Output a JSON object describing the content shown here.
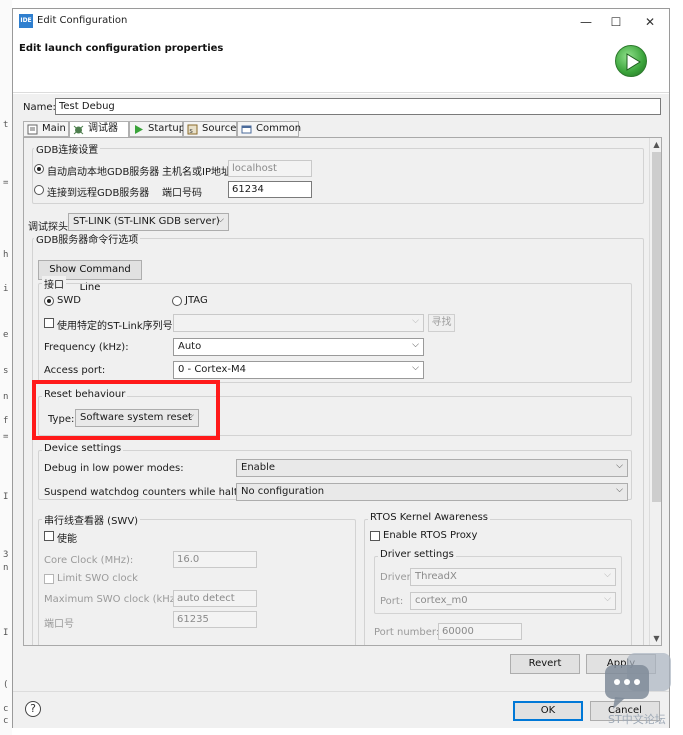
{
  "window": {
    "title": "Edit Configuration",
    "app_icon_text": "IDE",
    "minimize_glyph": "—",
    "maximize_glyph": "☐",
    "close_glyph": "✕"
  },
  "header": {
    "title": "Edit launch configuration properties",
    "icon": "run-debug-icon"
  },
  "name_label": "Name:",
  "name_value": "Test Debug",
  "tabs": [
    {
      "label": "Main",
      "icon": "main-tab-icon"
    },
    {
      "label": "调试器",
      "icon": "debugger-tab-icon",
      "active": true
    },
    {
      "label": "Startup",
      "icon": "startup-tab-icon"
    },
    {
      "label": "Source",
      "icon": "source-tab-icon"
    },
    {
      "label": "Common",
      "icon": "common-tab-icon"
    }
  ],
  "gdb_connection": {
    "group_label": "GDB连接设置",
    "local_radio": "自动启动本地GDB服务器",
    "host_label": "主机名或IP地址",
    "host_value": "localhost",
    "remote_radio": "连接到远程GDB服务器",
    "port_label": "端口号码",
    "port_value": "61234"
  },
  "probe": {
    "label": "调试探头",
    "value": "ST-LINK (ST-LINK GDB server)"
  },
  "gdb_server_options": {
    "group_label": "GDB服务器命令行选项",
    "show_cmd_button": "Show Command Line"
  },
  "interface": {
    "group_label": "接口",
    "swd": "SWD",
    "jtag": "JTAG",
    "serial_checkbox": "使用特定的ST-Link序列号",
    "scan_button": "寻找",
    "freq_label": "Frequency (kHz):",
    "freq_value": "Auto",
    "access_label": "Access port:",
    "access_value": "0 - Cortex-M4"
  },
  "reset": {
    "group_label": "Reset behaviour",
    "type_label": "Type:",
    "type_value": "Software system reset"
  },
  "device": {
    "group_label": "Device settings",
    "low_power_label": "Debug in low power modes:",
    "low_power_value": "Enable",
    "watchdog_label": "Suspend watchdog counters while halted:",
    "watchdog_value": "No configuration"
  },
  "swv": {
    "group_label": "串行线查看器 (SWV)",
    "enable_label": "使能",
    "core_clock_label": "Core Clock (MHz):",
    "core_clock_value": "16.0",
    "limit_swo_label": "Limit SWO clock",
    "max_swo_label": "Maximum SWO clock (kHz):",
    "max_swo_value": "auto detect",
    "port_label": "端口号",
    "port_value": "61235"
  },
  "rtos": {
    "group_label": "RTOS Kernel Awareness",
    "enable_label": "Enable RTOS Proxy",
    "driver_group_label": "Driver settings",
    "driver_label": "Driver:",
    "driver_value": "ThreadX",
    "port_label": "Port:",
    "port_value": "cortex_m0",
    "port_number_label": "Port number:",
    "port_number_value": "60000"
  },
  "buttons": {
    "revert": "Revert",
    "apply": "Apply",
    "ok": "OK",
    "cancel": "Cancel",
    "help": "?"
  },
  "watermark": {
    "text": "ST中文论坛"
  },
  "left_strip_chars": [
    "t",
    "=",
    "h",
    "i",
    "e",
    "s",
    "n",
    "f",
    "=",
    "I",
    "3",
    "n",
    "I",
    "(",
    "c",
    "c"
  ],
  "colors": {
    "highlight": "#ff1a1a",
    "accent": "#0078d7",
    "run_green": "#3aa33a"
  }
}
